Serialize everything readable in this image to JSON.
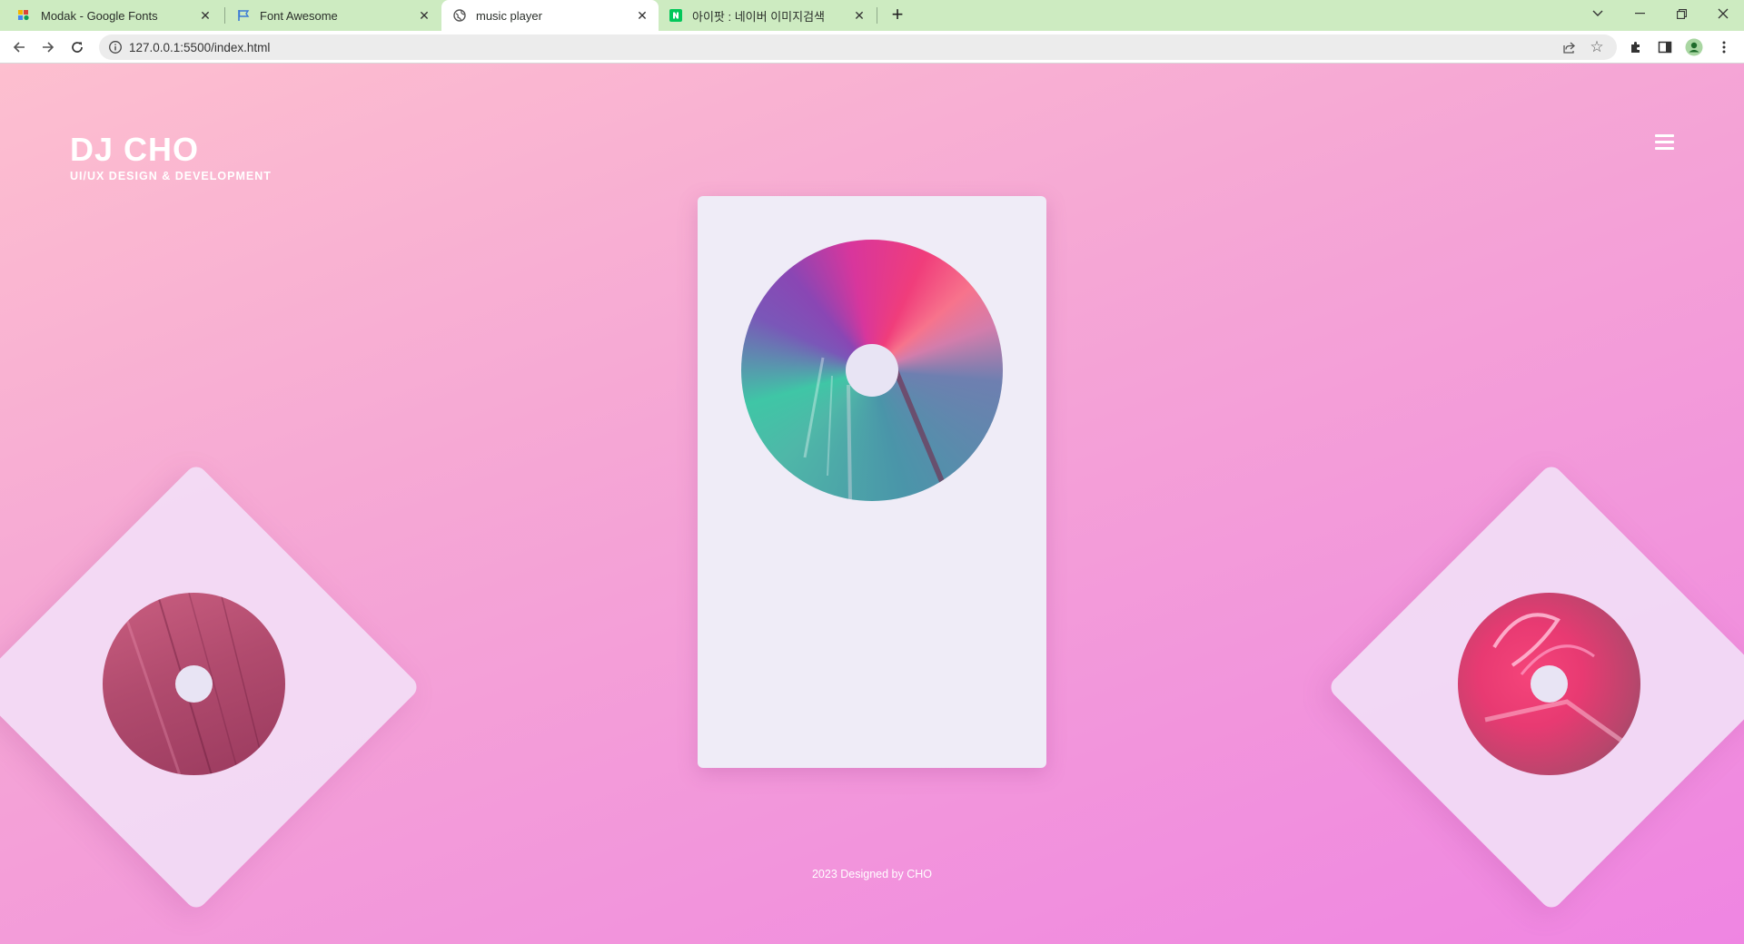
{
  "browser": {
    "tabs": [
      {
        "title": "Modak - Google Fonts",
        "favicon": "google-fonts-icon",
        "active": false
      },
      {
        "title": "Font Awesome",
        "favicon": "flag-icon",
        "active": false
      },
      {
        "title": "music player",
        "favicon": "globe-icon",
        "active": true
      },
      {
        "title": "아이팟 : 네이버 이미지검색",
        "favicon": "naver-icon",
        "active": false
      }
    ],
    "address": "127.0.0.1:5500/index.html"
  },
  "page": {
    "brand_name": "DJ CHO",
    "brand_tagline": "UI/UX DESIGN & DEVELOPMENT",
    "footer": "2023 Designed by CHO",
    "menu_icon": "hamburger-icon",
    "colors": {
      "background_top": "#fdbfcf",
      "background_bottom": "#ef85e2",
      "card": "#efecf7",
      "side_card": "#f2ddf6"
    }
  }
}
